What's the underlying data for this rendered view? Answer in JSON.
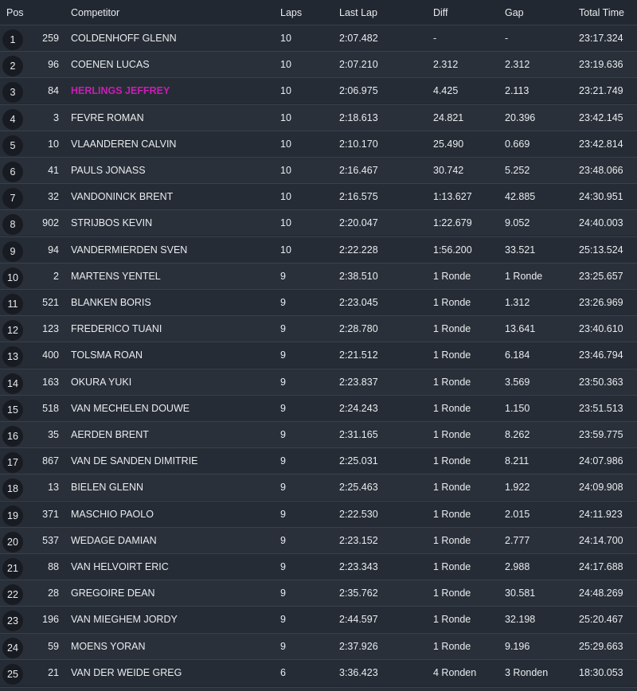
{
  "header": {
    "pos": "Pos",
    "competitor": "Competitor",
    "laps": "Laps",
    "last_lap": "Last Lap",
    "diff": "Diff",
    "gap": "Gap",
    "total_time": "Total Time"
  },
  "colors": {
    "background": "#222831",
    "row_even": "#262c35",
    "row_odd": "#2a3039",
    "highlight": "#c51fb3"
  },
  "rows": [
    {
      "pos": "1",
      "number": "259",
      "competitor": "COLDENHOFF GLENN",
      "laps": "10",
      "last_lap": "2:07.482",
      "diff": "-",
      "gap": "-",
      "total": "23:17.324"
    },
    {
      "pos": "2",
      "number": "96",
      "competitor": "COENEN LUCAS",
      "laps": "10",
      "last_lap": "2:07.210",
      "diff": "2.312",
      "gap": "2.312",
      "total": "23:19.636"
    },
    {
      "pos": "3",
      "number": "84",
      "competitor": "HERLINGS JEFFREY",
      "laps": "10",
      "last_lap": "2:06.975",
      "diff": "4.425",
      "gap": "2.113",
      "total": "23:21.749",
      "highlight": true
    },
    {
      "pos": "4",
      "number": "3",
      "competitor": "FEVRE ROMAN",
      "laps": "10",
      "last_lap": "2:18.613",
      "diff": "24.821",
      "gap": "20.396",
      "total": "23:42.145"
    },
    {
      "pos": "5",
      "number": "10",
      "competitor": "VLAANDEREN CALVIN",
      "laps": "10",
      "last_lap": "2:10.170",
      "diff": "25.490",
      "gap": "0.669",
      "total": "23:42.814"
    },
    {
      "pos": "6",
      "number": "41",
      "competitor": "PAULS JONASS",
      "laps": "10",
      "last_lap": "2:16.467",
      "diff": "30.742",
      "gap": "5.252",
      "total": "23:48.066"
    },
    {
      "pos": "7",
      "number": "32",
      "competitor": "VANDONINCK BRENT",
      "laps": "10",
      "last_lap": "2:16.575",
      "diff": "1:13.627",
      "gap": "42.885",
      "total": "24:30.951"
    },
    {
      "pos": "8",
      "number": "902",
      "competitor": "STRIJBOS KEVIN",
      "laps": "10",
      "last_lap": "2:20.047",
      "diff": "1:22.679",
      "gap": "9.052",
      "total": "24:40.003"
    },
    {
      "pos": "9",
      "number": "94",
      "competitor": "VANDERMIERDEN SVEN",
      "laps": "10",
      "last_lap": "2:22.228",
      "diff": "1:56.200",
      "gap": "33.521",
      "total": "25:13.524"
    },
    {
      "pos": "10",
      "number": "2",
      "competitor": "MARTENS YENTEL",
      "laps": "9",
      "last_lap": "2:38.510",
      "diff": "1 Ronde",
      "gap": "1 Ronde",
      "total": "23:25.657"
    },
    {
      "pos": "11",
      "number": "521",
      "competitor": "BLANKEN BORIS",
      "laps": "9",
      "last_lap": "2:23.045",
      "diff": "1 Ronde",
      "gap": "1.312",
      "total": "23:26.969"
    },
    {
      "pos": "12",
      "number": "123",
      "competitor": "FREDERICO TUANI",
      "laps": "9",
      "last_lap": "2:28.780",
      "diff": "1 Ronde",
      "gap": "13.641",
      "total": "23:40.610"
    },
    {
      "pos": "13",
      "number": "400",
      "competitor": "TOLSMA ROAN",
      "laps": "9",
      "last_lap": "2:21.512",
      "diff": "1 Ronde",
      "gap": "6.184",
      "total": "23:46.794"
    },
    {
      "pos": "14",
      "number": "163",
      "competitor": "OKURA YUKI",
      "laps": "9",
      "last_lap": "2:23.837",
      "diff": "1 Ronde",
      "gap": "3.569",
      "total": "23:50.363"
    },
    {
      "pos": "15",
      "number": "518",
      "competitor": "VAN MECHELEN DOUWE",
      "laps": "9",
      "last_lap": "2:24.243",
      "diff": "1 Ronde",
      "gap": "1.150",
      "total": "23:51.513"
    },
    {
      "pos": "16",
      "number": "35",
      "competitor": "AERDEN BRENT",
      "laps": "9",
      "last_lap": "2:31.165",
      "diff": "1 Ronde",
      "gap": "8.262",
      "total": "23:59.775"
    },
    {
      "pos": "17",
      "number": "867",
      "competitor": "VAN DE SANDEN DIMITRIE",
      "laps": "9",
      "last_lap": "2:25.031",
      "diff": "1 Ronde",
      "gap": "8.211",
      "total": "24:07.986"
    },
    {
      "pos": "18",
      "number": "13",
      "competitor": "BIELEN GLENN",
      "laps": "9",
      "last_lap": "2:25.463",
      "diff": "1 Ronde",
      "gap": "1.922",
      "total": "24:09.908"
    },
    {
      "pos": "19",
      "number": "371",
      "competitor": "MASCHIO PAOLO",
      "laps": "9",
      "last_lap": "2:22.530",
      "diff": "1 Ronde",
      "gap": "2.015",
      "total": "24:11.923"
    },
    {
      "pos": "20",
      "number": "537",
      "competitor": "WEDAGE DAMIAN",
      "laps": "9",
      "last_lap": "2:23.152",
      "diff": "1 Ronde",
      "gap": "2.777",
      "total": "24:14.700"
    },
    {
      "pos": "21",
      "number": "88",
      "competitor": "VAN HELVOIRT ERIC",
      "laps": "9",
      "last_lap": "2:23.343",
      "diff": "1 Ronde",
      "gap": "2.988",
      "total": "24:17.688"
    },
    {
      "pos": "22",
      "number": "28",
      "competitor": "GREGOIRE DEAN",
      "laps": "9",
      "last_lap": "2:35.762",
      "diff": "1 Ronde",
      "gap": "30.581",
      "total": "24:48.269"
    },
    {
      "pos": "23",
      "number": "196",
      "competitor": "VAN MIEGHEM JORDY",
      "laps": "9",
      "last_lap": "2:44.597",
      "diff": "1 Ronde",
      "gap": "32.198",
      "total": "25:20.467"
    },
    {
      "pos": "24",
      "number": "59",
      "competitor": "MOENS YORAN",
      "laps": "9",
      "last_lap": "2:37.926",
      "diff": "1 Ronde",
      "gap": "9.196",
      "total": "25:29.663"
    },
    {
      "pos": "25",
      "number": "21",
      "competitor": "VAN DER WEIDE GREG",
      "laps": "6",
      "last_lap": "3:36.423",
      "diff": "4 Ronden",
      "gap": "3 Ronden",
      "total": "18:30.053"
    }
  ]
}
